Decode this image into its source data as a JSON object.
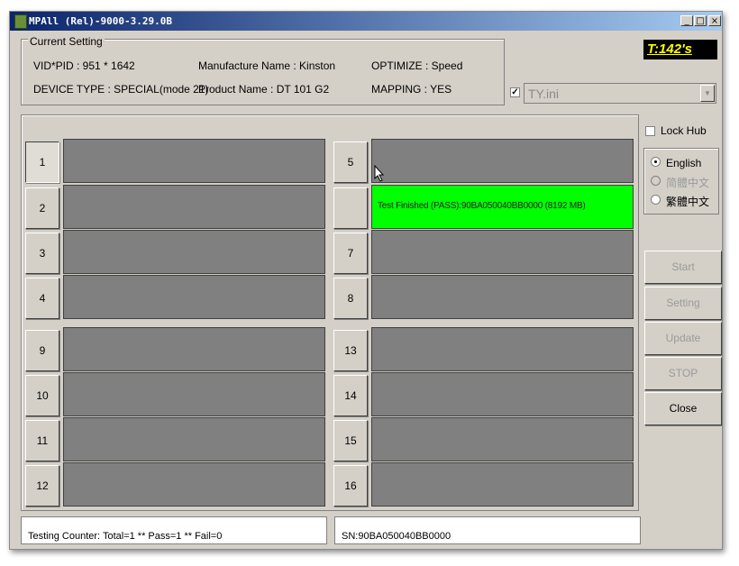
{
  "window": {
    "title": "MPAll (Rel)-9000-3.29.0B",
    "controls": [
      "_",
      "□",
      "×"
    ]
  },
  "current_setting": {
    "legend": "Current Setting",
    "vid_pid": "VID*PID :  951 * 1642",
    "manufacture_name": "Manufacture Name : Kinston",
    "optimize": "OPTIMIZE : Speed",
    "device_type": "DEVICE TYPE : SPECIAL(mode 21)",
    "product_name": "Product Name : DT 101 G2",
    "mapping": "MAPPING : YES"
  },
  "timer": "T:142's",
  "ini": {
    "checked": true,
    "value": "TY.ini"
  },
  "lock_hub": {
    "label": "Lock Hub",
    "checked": false
  },
  "languages": [
    {
      "label": "English",
      "selected": true,
      "enabled": true
    },
    {
      "label": "简體中文",
      "selected": false,
      "enabled": false
    },
    {
      "label": "繁體中文",
      "selected": false,
      "enabled": true
    }
  ],
  "slots": [
    {
      "number": "1",
      "status": "",
      "state": "idle"
    },
    {
      "number": "2",
      "status": "",
      "state": "idle"
    },
    {
      "number": "3",
      "status": "",
      "state": "idle"
    },
    {
      "number": "4",
      "status": "",
      "state": "idle"
    },
    {
      "number": "5",
      "status": "",
      "state": "idle"
    },
    {
      "number": "",
      "status": "Test Finished (PASS):90BA050040BB0000 (8192 MB)",
      "state": "pass"
    },
    {
      "number": "7",
      "status": "",
      "state": "idle"
    },
    {
      "number": "8",
      "status": "",
      "state": "idle"
    },
    {
      "number": "9",
      "status": "",
      "state": "idle"
    },
    {
      "number": "10",
      "status": "",
      "state": "idle"
    },
    {
      "number": "11",
      "status": "",
      "state": "idle"
    },
    {
      "number": "12",
      "status": "",
      "state": "idle"
    },
    {
      "number": "13",
      "status": "",
      "state": "idle"
    },
    {
      "number": "14",
      "status": "",
      "state": "idle"
    },
    {
      "number": "15",
      "status": "",
      "state": "idle"
    },
    {
      "number": "16",
      "status": "",
      "state": "idle"
    }
  ],
  "side_buttons": [
    {
      "label": "Start",
      "enabled": false
    },
    {
      "label": "Setting",
      "enabled": false
    },
    {
      "label": "Update",
      "enabled": false
    },
    {
      "label": "STOP",
      "enabled": false
    },
    {
      "label": "Close",
      "enabled": true
    }
  ],
  "status_bar": {
    "counter": "Testing Counter: Total=1 ** Pass=1 ** Fail=0",
    "serial": "SN:90BA050040BB0000"
  },
  "colors": {
    "titlebar_start": "#0a246a",
    "titlebar_end": "#a6caf0",
    "pass": "#00ff00",
    "idle": "#808080",
    "timer_bg": "#000000",
    "timer_fg": "#ffff00"
  }
}
